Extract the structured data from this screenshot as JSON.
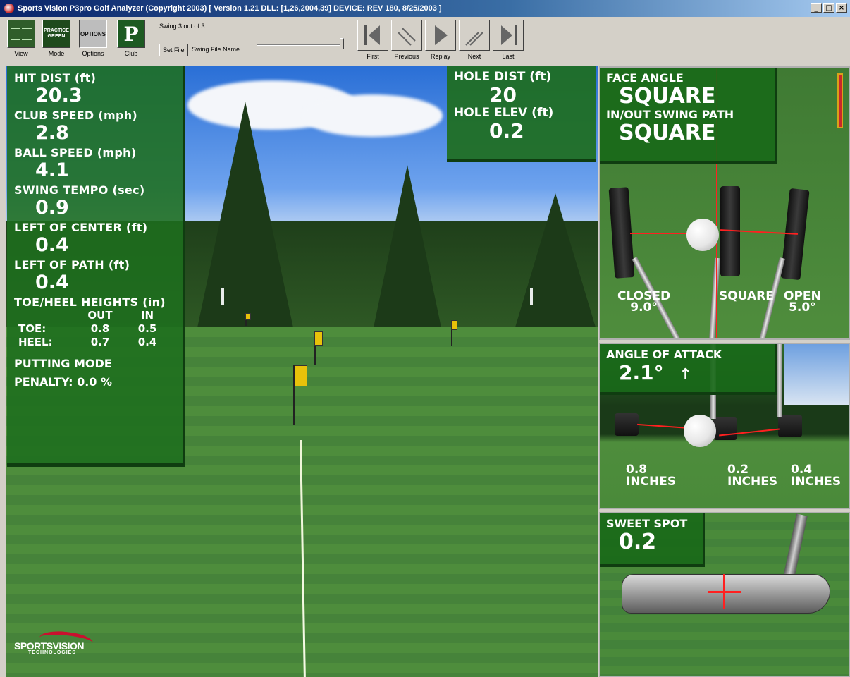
{
  "window": {
    "title": "Sports Vision P3pro Golf Analyzer (Copyright 2003)   [ Version 1.21  DLL: [1,26,2004,39]  DEVICE: REV 180, 8/25/2003 ]",
    "buttons": {
      "minimize": "_",
      "maximize": "□",
      "close": "×"
    }
  },
  "toolbar": {
    "view_label": "View",
    "mode_label": "Mode",
    "mode_icon_text": "PRACTICE GREEN",
    "options_label": "Options",
    "options_icon_text": "OPTIONS",
    "club_label": "Club",
    "club_icon_text": "P",
    "swing_count": "Swing 3 out of 3",
    "set_file_label": "Set File",
    "swing_file_name": "Swing File Name",
    "nav": {
      "first": "First",
      "previous": "Previous",
      "replay": "Replay",
      "next": "Next",
      "last": "Last"
    }
  },
  "stats": {
    "hit_dist": {
      "label": "HIT DIST (ft)",
      "value": "20.3"
    },
    "club_speed": {
      "label": "CLUB SPEED (mph)",
      "value": "2.8"
    },
    "ball_speed": {
      "label": "BALL SPEED (mph)",
      "value": "4.1"
    },
    "swing_tempo": {
      "label": "SWING TEMPO (sec)",
      "value": "0.9"
    },
    "left_of_center": {
      "label": "LEFT OF CENTER (ft)",
      "value": "0.4"
    },
    "left_of_path": {
      "label": "LEFT OF PATH (ft)",
      "value": "0.4"
    },
    "toe_heel": {
      "label": "TOE/HEEL HEIGHTS (in)",
      "col_out": "OUT",
      "col_in": "IN",
      "toe_label": "TOE:",
      "toe_out": "0.8",
      "toe_in": "0.5",
      "heel_label": "HEEL:",
      "heel_out": "0.7",
      "heel_in": "0.4"
    },
    "mode": "PUTTING MODE",
    "penalty_label": "PENALTY:",
    "penalty_value": "0.0 %"
  },
  "hole": {
    "dist_label": "HOLE DIST (ft)",
    "dist_value": "20",
    "elev_label": "HOLE ELEV (ft)",
    "elev_value": "0.2"
  },
  "face": {
    "face_angle_label": "FACE ANGLE",
    "face_angle_value": "SQUARE",
    "swing_path_label": "IN/OUT SWING PATH",
    "swing_path_value": "SQUARE",
    "closed_label": "CLOSED",
    "closed_value": "9.0°",
    "square_label": "SQUARE",
    "open_label": "OPEN",
    "open_value": "5.0°"
  },
  "attack": {
    "label": "ANGLE OF ATTACK",
    "value": "2.1°",
    "arrow": "↑",
    "left_value": "0.8",
    "left_unit": "INCHES",
    "mid_value": "0.2",
    "mid_unit": "INCHES",
    "right_value": "0.4",
    "right_unit": "INCHES"
  },
  "sweet_spot": {
    "label": "SWEET SPOT",
    "value": "0.2"
  },
  "logo": {
    "name": "SPORTSVISION",
    "sub": "TECHNOLOGIES"
  },
  "colors": {
    "panel_green": "#1e6e1e",
    "accent_red": "#ff2020",
    "flag_yellow": "#e8c20a"
  }
}
